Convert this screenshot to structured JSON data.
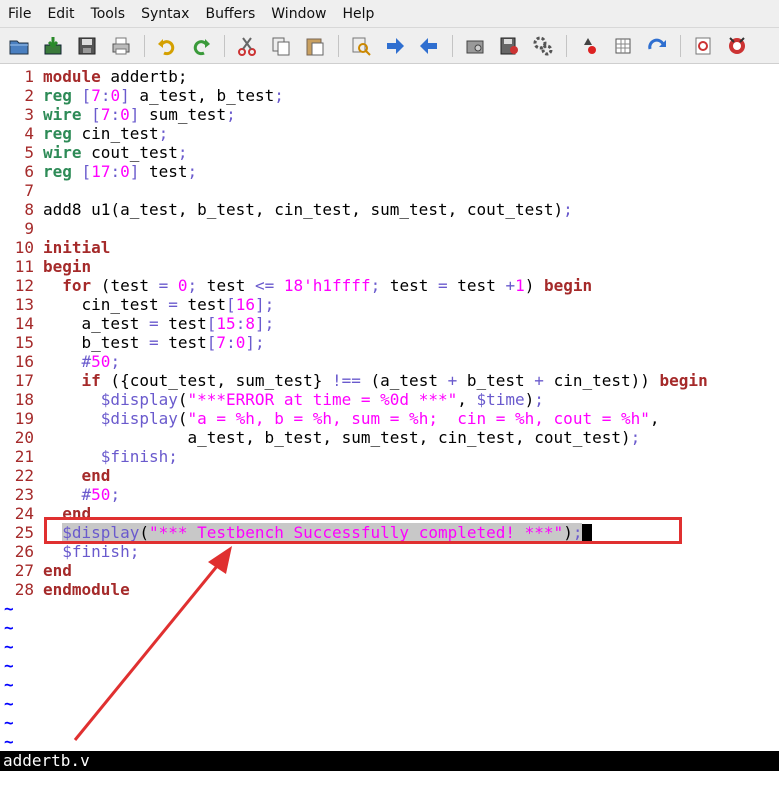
{
  "menu": [
    "File",
    "Edit",
    "Tools",
    "Syntax",
    "Buffers",
    "Window",
    "Help"
  ],
  "toolbar": {
    "icons": [
      "open-icon",
      "save-icon",
      "save-all-icon",
      "print-icon",
      "undo-icon",
      "redo-icon",
      "cut-icon",
      "copy-icon",
      "paste-icon",
      "find-replace-icon",
      "find-next-icon",
      "find-prev-icon",
      "load-session-icon",
      "save-session-icon",
      "run-script-icon",
      "make-icon",
      "run-ctags-icon",
      "jump-tag-icon",
      "help-icon",
      "find-help-icon"
    ]
  },
  "editor": {
    "lines": [
      {
        "n": "1",
        "text": "module addertb;"
      },
      {
        "n": "2",
        "text": "reg [7:0] a_test, b_test;"
      },
      {
        "n": "3",
        "text": "wire [7:0] sum_test;"
      },
      {
        "n": "4",
        "text": "reg cin_test;"
      },
      {
        "n": "5",
        "text": "wire cout_test;"
      },
      {
        "n": "6",
        "text": "reg [17:0] test;"
      },
      {
        "n": "7",
        "text": ""
      },
      {
        "n": "8",
        "text": "add8 u1(a_test, b_test, cin_test, sum_test, cout_test);"
      },
      {
        "n": "9",
        "text": ""
      },
      {
        "n": "10",
        "text": "initial"
      },
      {
        "n": "11",
        "text": "begin"
      },
      {
        "n": "12",
        "text": "  for (test = 0; test <= 18'h1ffff; test = test +1) begin"
      },
      {
        "n": "13",
        "text": "    cin_test = test[16];"
      },
      {
        "n": "14",
        "text": "    a_test = test[15:8];"
      },
      {
        "n": "15",
        "text": "    b_test = test[7:0];"
      },
      {
        "n": "16",
        "text": "    #50;"
      },
      {
        "n": "17",
        "text": "    if ({cout_test, sum_test} !== (a_test + b_test + cin_test)) begin"
      },
      {
        "n": "18",
        "text": "      $display(\"***ERROR at time = %0d ***\", $time);"
      },
      {
        "n": "19",
        "text": "      $display(\"a = %h, b = %h, sum = %h;  cin = %h, cout = %h\","
      },
      {
        "n": "20",
        "text": "               a_test, b_test, sum_test, cin_test, cout_test);"
      },
      {
        "n": "21",
        "text": "      $finish;"
      },
      {
        "n": "22",
        "text": "    end"
      },
      {
        "n": "23",
        "text": "    #50;"
      },
      {
        "n": "24",
        "text": "  end"
      },
      {
        "n": "25",
        "text": "  $display(\"*** Testbench Successfully completed! ***\");"
      },
      {
        "n": "26",
        "text": "  $finish;"
      },
      {
        "n": "27",
        "text": "end"
      },
      {
        "n": "28",
        "text": "endmodule"
      }
    ],
    "tilde": "~",
    "tilde_count": 8,
    "highlighted_line": "25"
  },
  "status": {
    "filename": "addertb.v"
  },
  "colors": {
    "keyword": "#a52a2a",
    "type": "#2e8b57",
    "number": "#ff00ff",
    "system": "#6a5acd",
    "string": "#ff00ff",
    "callout": "#e03030"
  }
}
